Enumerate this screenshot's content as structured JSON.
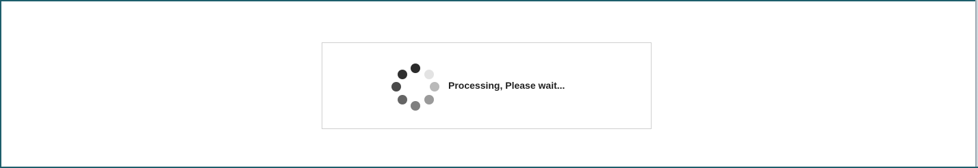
{
  "loading_dialog": {
    "message": "Processing, Please wait...",
    "spinner_icon": "loading-spinner-icon",
    "spinner_dot_colors": [
      "#2b2b2b",
      "#e3e3e3",
      "#b9b9b9",
      "#9a9a9a",
      "#7f7f7f",
      "#656565",
      "#4a4a4a",
      "#2f2f2f"
    ]
  },
  "colors": {
    "frame_border": "#1d5e6b",
    "dialog_border": "#cfcfcf",
    "text": "#222222"
  }
}
